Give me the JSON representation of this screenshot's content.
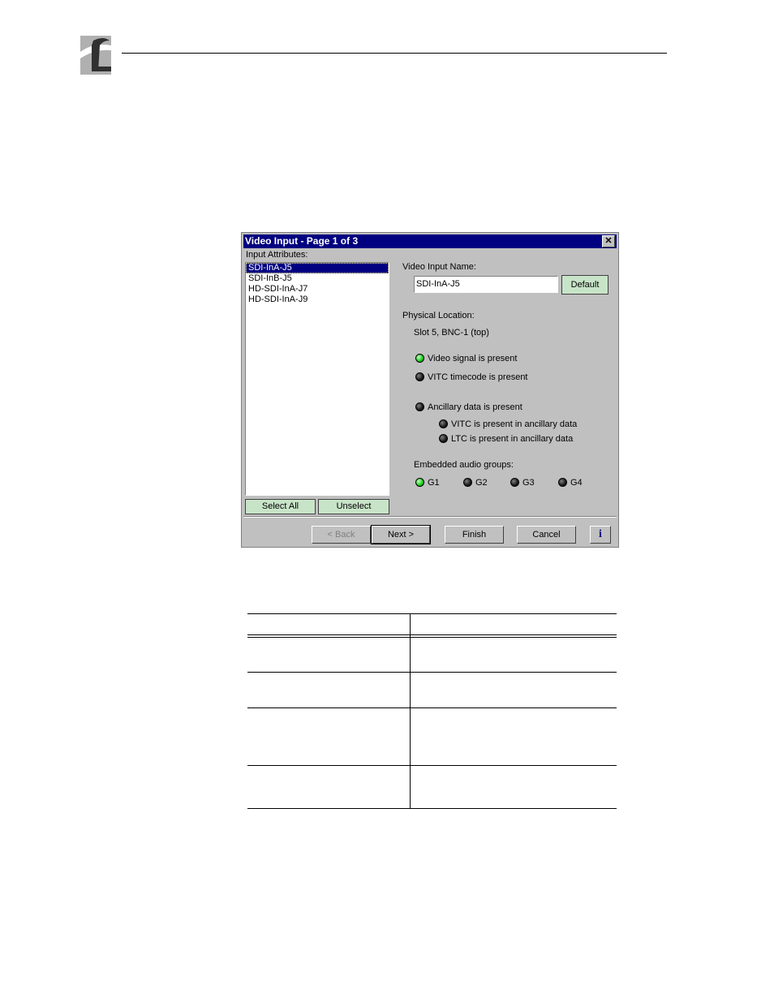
{
  "dialog": {
    "title": "Video Input - Page 1 of 3",
    "close_glyph": "✕",
    "input_attributes_label": "Input Attributes:",
    "list_items": [
      "SDI-InA-J5",
      "SDI-InB-J5",
      "HD-SDI-InA-J7",
      "HD-SDI-InA-J9"
    ],
    "selected_index": 0,
    "select_all_label": "Select All",
    "unselect_label": "Unselect",
    "video_input_name_label": "Video Input Name:",
    "video_input_name_value": "SDI-InA-J5",
    "default_label": "Default",
    "physical_location_label": "Physical Location:",
    "physical_location_value": "Slot 5, BNC-1 (top)",
    "status": {
      "video_signal": "Video signal is present",
      "vitc_timecode": "VITC timecode is present",
      "ancillary": "Ancillary data is present",
      "vitc_ancillary": "VITC is present in ancillary data",
      "ltc_ancillary": "LTC is present in ancillary data"
    },
    "status_on": {
      "video_signal": true,
      "vitc_timecode": false,
      "ancillary": false,
      "vitc_ancillary": false,
      "ltc_ancillary": false
    },
    "embedded_audio_label": "Embedded audio groups:",
    "audio_groups": [
      "G1",
      "G2",
      "G3",
      "G4"
    ],
    "audio_groups_on": [
      true,
      false,
      false,
      false
    ],
    "back_label": "< Back",
    "next_label": "Next >",
    "finish_label": "Finish",
    "cancel_label": "Cancel",
    "info_label": "i"
  },
  "colors": {
    "titlebar": "#000080",
    "led_on": "#20d020",
    "led_off": "#202020",
    "green_button": "#c8e4c8"
  }
}
